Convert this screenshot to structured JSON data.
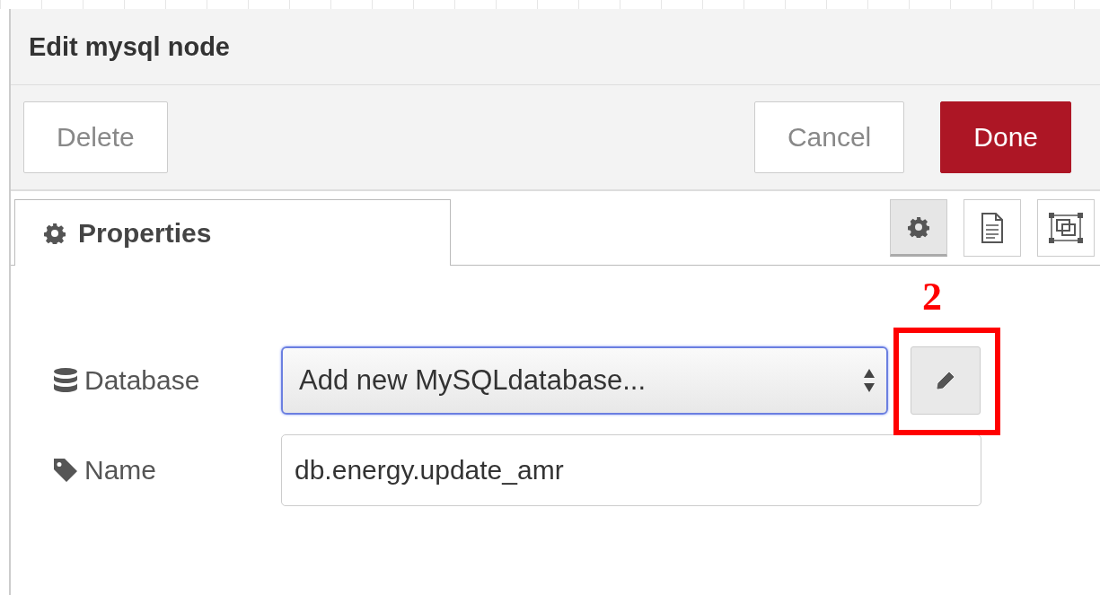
{
  "tray": {
    "title": "Edit mysql node"
  },
  "actions": [
    {
      "label": "Delete",
      "kind": "plain"
    },
    {
      "label": "Cancel",
      "kind": "plain"
    },
    {
      "label": "Done",
      "kind": "primary"
    }
  ],
  "tab": {
    "label": "Properties",
    "selected": true
  },
  "side_tabs": [
    {
      "kind": "gear",
      "selected": true
    },
    {
      "kind": "document",
      "selected": false
    },
    {
      "kind": "frame",
      "selected": false
    }
  ],
  "fields": [
    {
      "kind": "select",
      "label": "Database",
      "value": "Add new MySQLdatabase...",
      "focused": true
    },
    {
      "kind": "text",
      "label": "Name",
      "value": "db.energy.update_amr",
      "focused": false
    }
  ],
  "annotation": {
    "label": "2"
  }
}
